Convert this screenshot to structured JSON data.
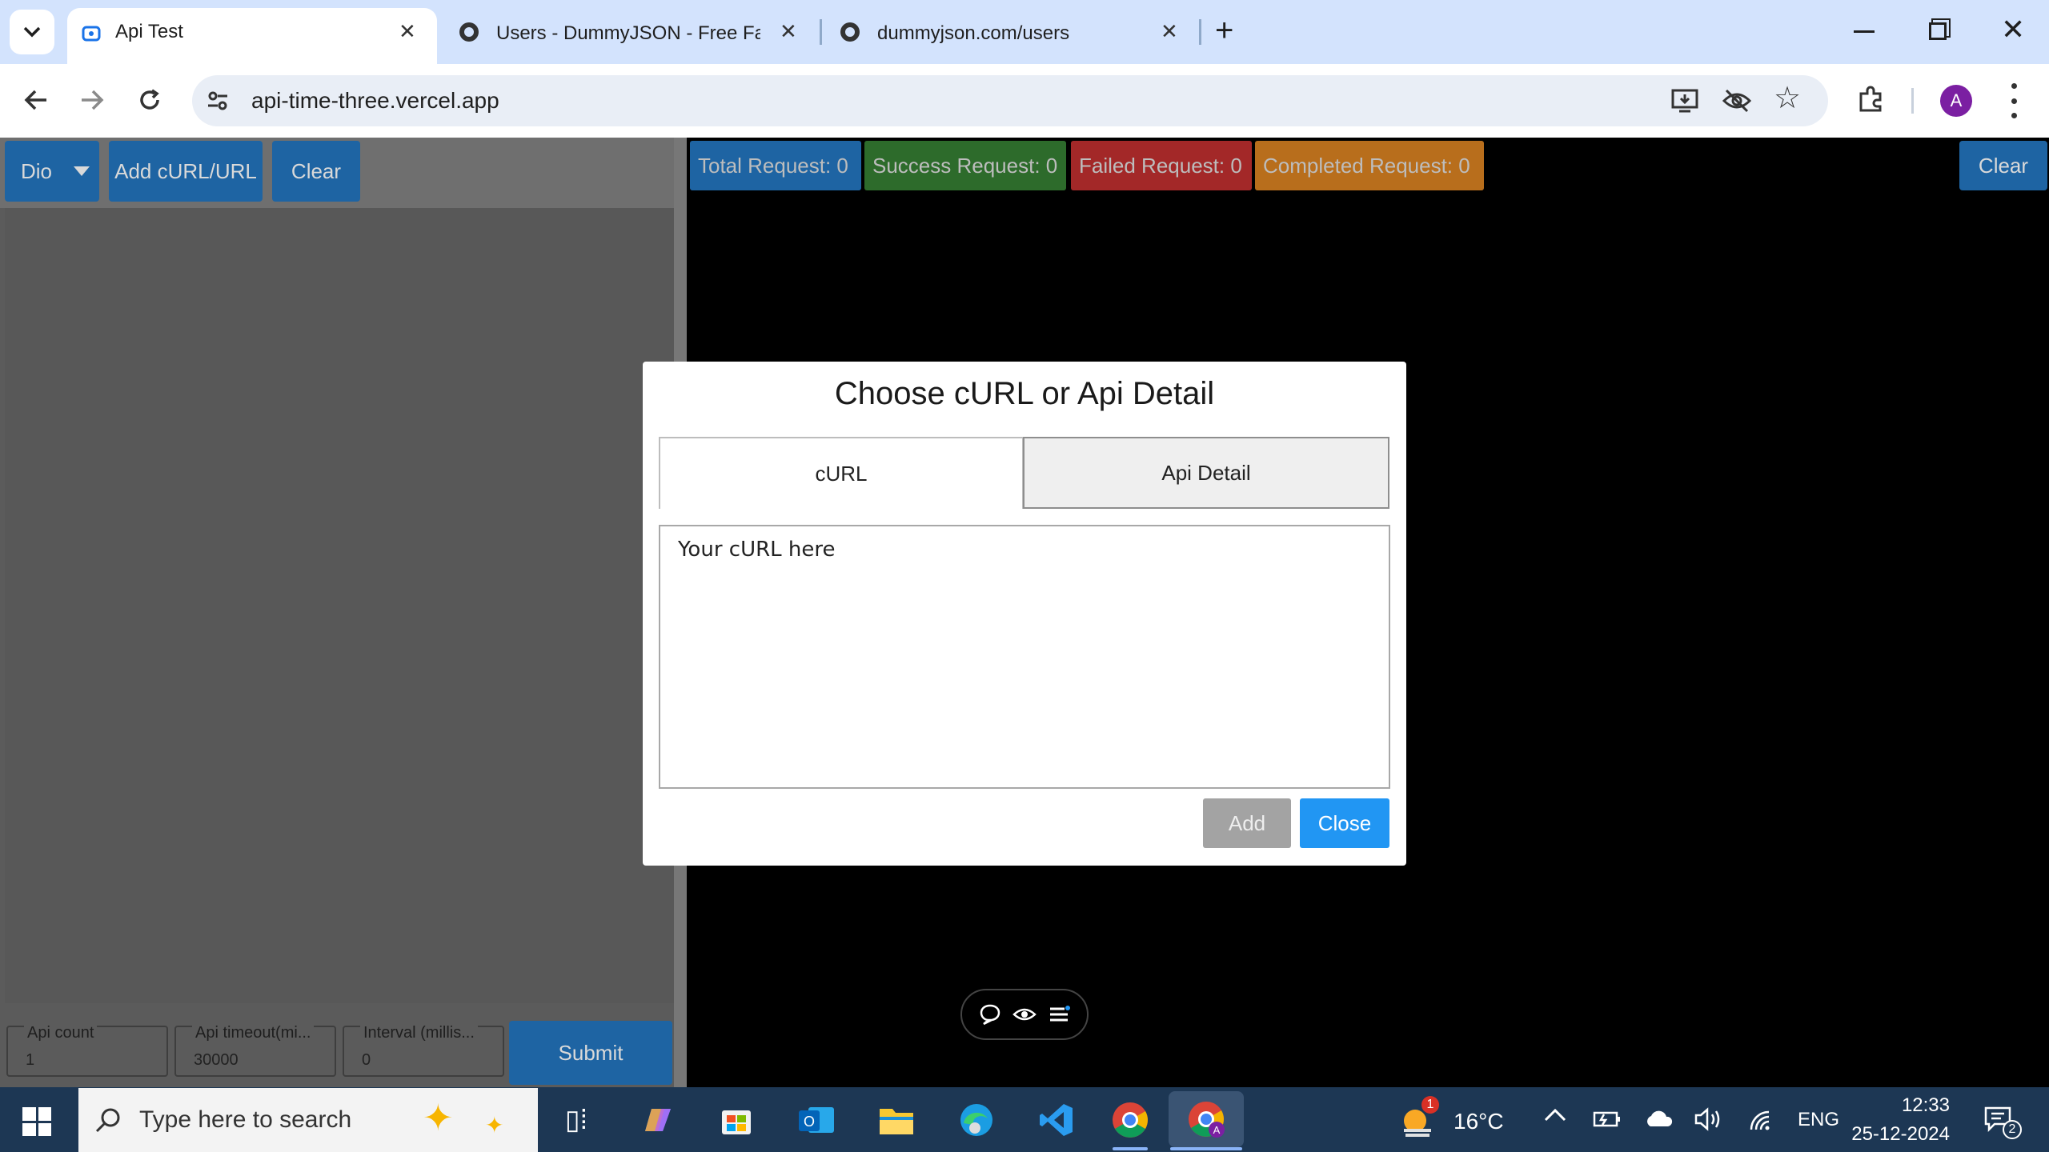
{
  "browser": {
    "tabs": [
      {
        "title": "Api Test",
        "active": true
      },
      {
        "title": "Users - DummyJSON - Free Fak",
        "active": false
      },
      {
        "title": "dummyjson.com/users",
        "active": false
      }
    ],
    "url": "api-time-three.vercel.app",
    "profile_initial": "A"
  },
  "left": {
    "dropdown_label": "Dio",
    "add_label": "Add cURL/URL",
    "clear_label": "Clear",
    "api_count_label": "Api count",
    "api_count_value": "1",
    "timeout_label": "Api timeout(mi...",
    "timeout_value": "30000",
    "interval_label": "Interval (millis...",
    "interval_value": "0",
    "submit_label": "Submit"
  },
  "stats": {
    "total": "Total Request: 0",
    "success": "Success Request: 0",
    "failed": "Failed Request: 0",
    "completed": "Completed Request: 0",
    "clear_label": "Clear"
  },
  "modal": {
    "title": "Choose cURL or Api Detail",
    "tab_curl": "cURL",
    "tab_detail": "Api Detail",
    "placeholder": "Your cURL here",
    "add_label": "Add",
    "close_label": "Close"
  },
  "taskbar": {
    "search_placeholder": "Type here to search",
    "weather_temp": "16°C",
    "weather_badge": "1",
    "language": "ENG",
    "time": "12:33",
    "date": "25-12-2024",
    "notification_count": "2"
  },
  "colors": {
    "accent_blue": "#1e64a3",
    "success_green": "#2d6b2b",
    "failed_red": "#a32828",
    "completed_orange": "#b86e1c",
    "close_button": "#2196f3"
  }
}
